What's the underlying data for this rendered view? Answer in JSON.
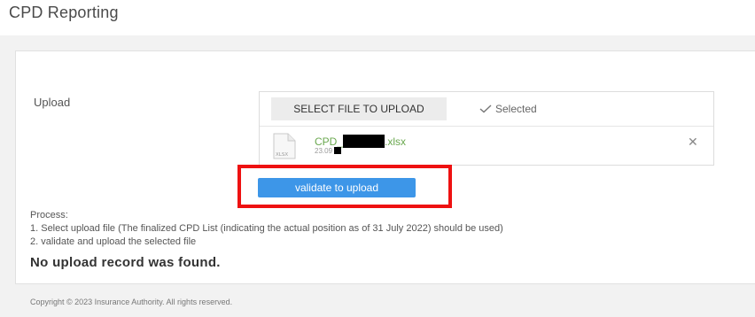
{
  "page": {
    "title": "CPD Reporting"
  },
  "form": {
    "upload_label": "Upload",
    "select_button": "SELECT FILE TO UPLOAD",
    "selected_status": "Selected",
    "file": {
      "name_prefix": "CPD_",
      "name_suffix": ".xlsx",
      "meta_prefix": "23.09",
      "type_label": "XLSX",
      "icon": "file-icon"
    },
    "validate_button": "validate to upload"
  },
  "process": {
    "heading": "Process:",
    "steps": [
      "1. Select upload file (The finalized CPD List (indicating the actual position as of 31 July 2022) should be used)",
      "2. validate and upload the selected file"
    ]
  },
  "status": {
    "no_record": "No upload record was found."
  },
  "footer": {
    "copyright": "Copyright © 2023 Insurance Authority. All rights reserved."
  },
  "colors": {
    "accent": "#3d96e8",
    "highlight": "#ee1111",
    "file_name": "#6aa84f"
  },
  "icons": {
    "check": "check-icon",
    "remove": "close-icon"
  }
}
